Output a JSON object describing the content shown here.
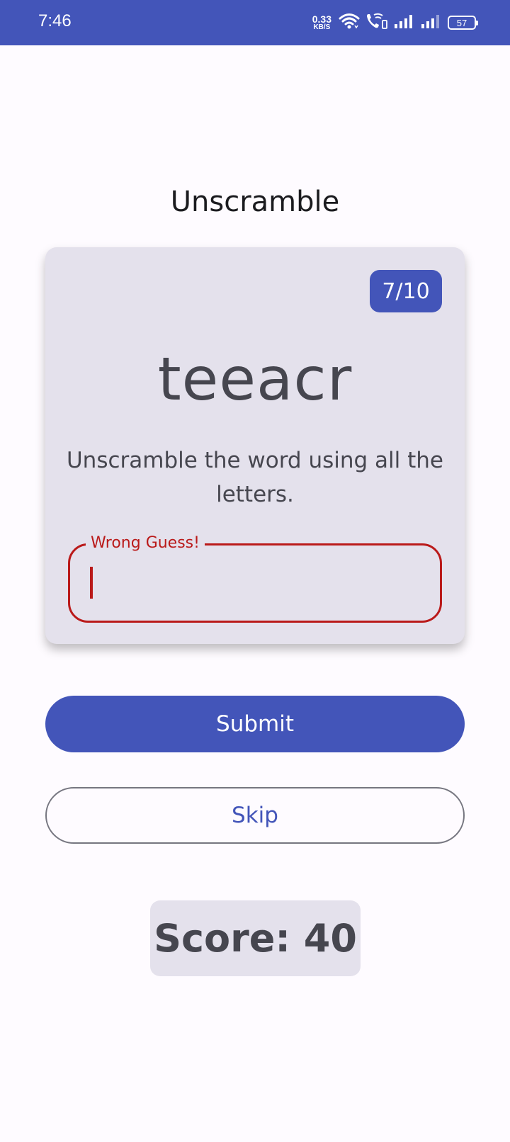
{
  "status_bar": {
    "time": "7:46",
    "net_speed_value": "0.33",
    "net_speed_unit": "KB/S",
    "battery": "57",
    "icons": [
      "wifi-icon",
      "wifi-calling-icon",
      "signal-icon",
      "signal-icon",
      "battery-icon"
    ],
    "background": "#4355b9"
  },
  "app": {
    "title": "Unscramble"
  },
  "card": {
    "word_count": "7/10",
    "scrambled_word": "teeacr",
    "instructions": "Unscramble the word using all the letters.",
    "field_label": "Wrong Guess!",
    "field_value": "",
    "error_color": "#ba1a1a"
  },
  "actions": {
    "submit_label": "Submit",
    "skip_label": "Skip",
    "primary_color": "#4355b9"
  },
  "score": {
    "text": "Score: 40"
  }
}
